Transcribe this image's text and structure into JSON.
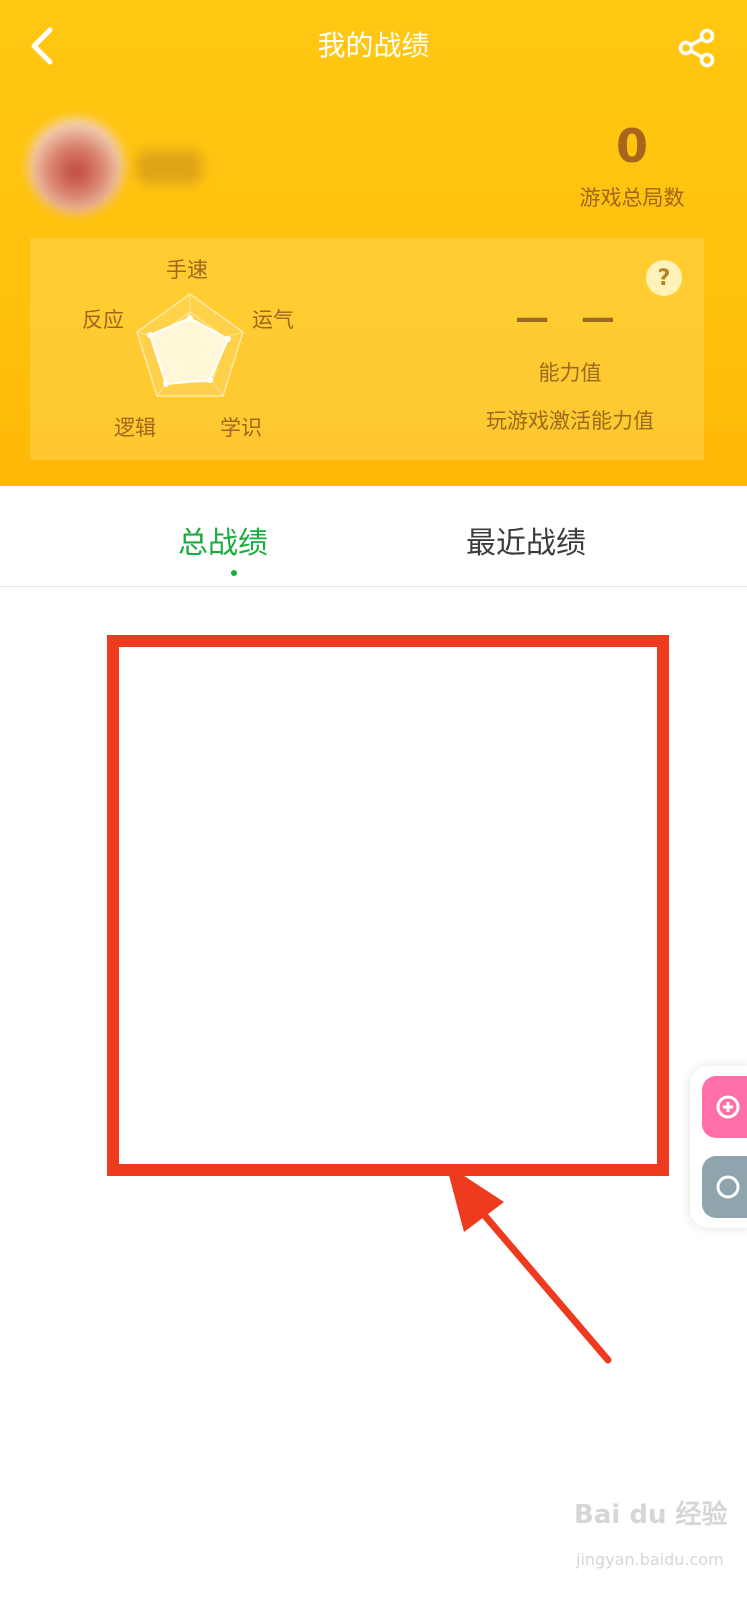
{
  "header": {
    "title": "我的战绩",
    "total_games_value": "0",
    "total_games_label": "游戏总局数"
  },
  "ability": {
    "axes": [
      "手速",
      "运气",
      "学识",
      "逻辑",
      "反应"
    ],
    "value": "— —",
    "value_label": "能力值",
    "hint": "玩游戏激活能力值",
    "help": "?"
  },
  "tabs": [
    {
      "label": "总战绩",
      "active": true
    },
    {
      "label": "最近战绩",
      "active": false
    }
  ],
  "watermark": {
    "logo": "Bai du 经验",
    "url": "jingyan.baidu.com"
  },
  "colors": {
    "header": "#ffc10d",
    "accent_green": "#19ad3c",
    "annotation_red": "#ee3a1f",
    "float_pink": "#ff6fa9",
    "float_gray": "#8fa4ac"
  },
  "icons": {
    "back": "chevron-left-icon",
    "share": "share-icon",
    "help": "question-icon",
    "float_top": "plus-icon",
    "float_bottom": "chat-icon"
  }
}
